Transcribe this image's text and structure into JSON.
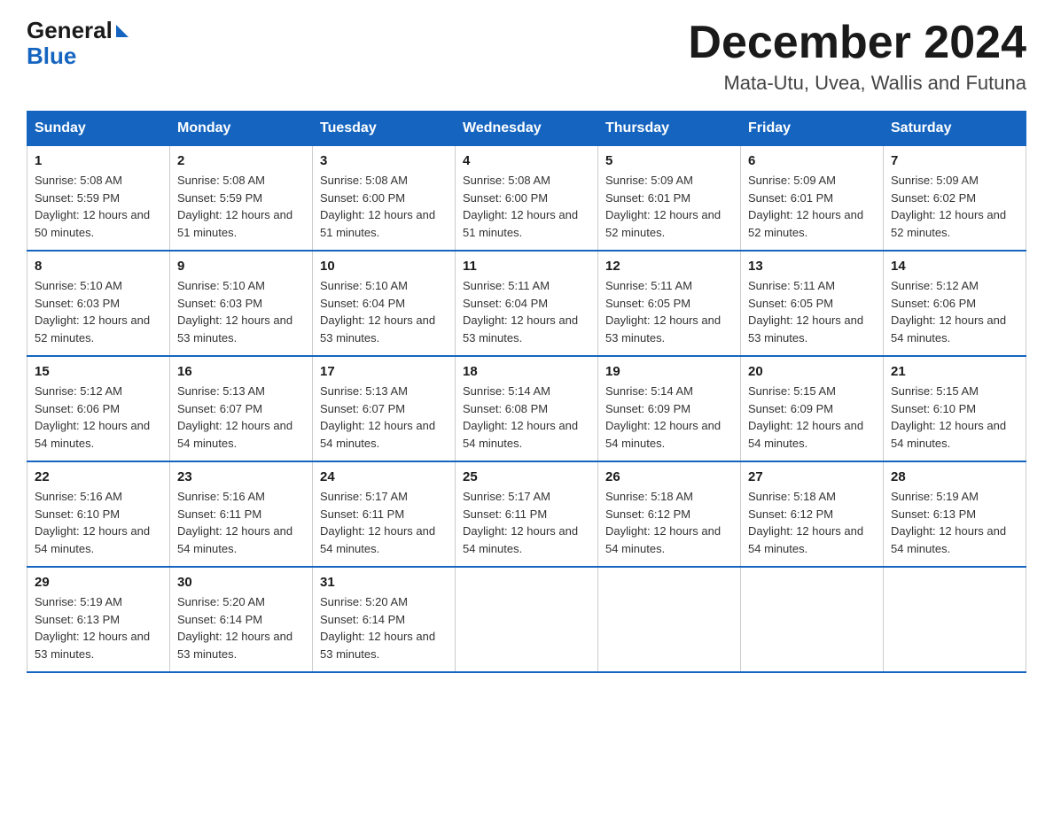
{
  "logo": {
    "general": "General",
    "blue": "Blue"
  },
  "title": "December 2024",
  "subtitle": "Mata-Utu, Uvea, Wallis and Futuna",
  "weekdays": [
    "Sunday",
    "Monday",
    "Tuesday",
    "Wednesday",
    "Thursday",
    "Friday",
    "Saturday"
  ],
  "weeks": [
    [
      {
        "day": "1",
        "sunrise": "5:08 AM",
        "sunset": "5:59 PM",
        "daylight": "12 hours and 50 minutes."
      },
      {
        "day": "2",
        "sunrise": "5:08 AM",
        "sunset": "5:59 PM",
        "daylight": "12 hours and 51 minutes."
      },
      {
        "day": "3",
        "sunrise": "5:08 AM",
        "sunset": "6:00 PM",
        "daylight": "12 hours and 51 minutes."
      },
      {
        "day": "4",
        "sunrise": "5:08 AM",
        "sunset": "6:00 PM",
        "daylight": "12 hours and 51 minutes."
      },
      {
        "day": "5",
        "sunrise": "5:09 AM",
        "sunset": "6:01 PM",
        "daylight": "12 hours and 52 minutes."
      },
      {
        "day": "6",
        "sunrise": "5:09 AM",
        "sunset": "6:01 PM",
        "daylight": "12 hours and 52 minutes."
      },
      {
        "day": "7",
        "sunrise": "5:09 AM",
        "sunset": "6:02 PM",
        "daylight": "12 hours and 52 minutes."
      }
    ],
    [
      {
        "day": "8",
        "sunrise": "5:10 AM",
        "sunset": "6:03 PM",
        "daylight": "12 hours and 52 minutes."
      },
      {
        "day": "9",
        "sunrise": "5:10 AM",
        "sunset": "6:03 PM",
        "daylight": "12 hours and 53 minutes."
      },
      {
        "day": "10",
        "sunrise": "5:10 AM",
        "sunset": "6:04 PM",
        "daylight": "12 hours and 53 minutes."
      },
      {
        "day": "11",
        "sunrise": "5:11 AM",
        "sunset": "6:04 PM",
        "daylight": "12 hours and 53 minutes."
      },
      {
        "day": "12",
        "sunrise": "5:11 AM",
        "sunset": "6:05 PM",
        "daylight": "12 hours and 53 minutes."
      },
      {
        "day": "13",
        "sunrise": "5:11 AM",
        "sunset": "6:05 PM",
        "daylight": "12 hours and 53 minutes."
      },
      {
        "day": "14",
        "sunrise": "5:12 AM",
        "sunset": "6:06 PM",
        "daylight": "12 hours and 54 minutes."
      }
    ],
    [
      {
        "day": "15",
        "sunrise": "5:12 AM",
        "sunset": "6:06 PM",
        "daylight": "12 hours and 54 minutes."
      },
      {
        "day": "16",
        "sunrise": "5:13 AM",
        "sunset": "6:07 PM",
        "daylight": "12 hours and 54 minutes."
      },
      {
        "day": "17",
        "sunrise": "5:13 AM",
        "sunset": "6:07 PM",
        "daylight": "12 hours and 54 minutes."
      },
      {
        "day": "18",
        "sunrise": "5:14 AM",
        "sunset": "6:08 PM",
        "daylight": "12 hours and 54 minutes."
      },
      {
        "day": "19",
        "sunrise": "5:14 AM",
        "sunset": "6:09 PM",
        "daylight": "12 hours and 54 minutes."
      },
      {
        "day": "20",
        "sunrise": "5:15 AM",
        "sunset": "6:09 PM",
        "daylight": "12 hours and 54 minutes."
      },
      {
        "day": "21",
        "sunrise": "5:15 AM",
        "sunset": "6:10 PM",
        "daylight": "12 hours and 54 minutes."
      }
    ],
    [
      {
        "day": "22",
        "sunrise": "5:16 AM",
        "sunset": "6:10 PM",
        "daylight": "12 hours and 54 minutes."
      },
      {
        "day": "23",
        "sunrise": "5:16 AM",
        "sunset": "6:11 PM",
        "daylight": "12 hours and 54 minutes."
      },
      {
        "day": "24",
        "sunrise": "5:17 AM",
        "sunset": "6:11 PM",
        "daylight": "12 hours and 54 minutes."
      },
      {
        "day": "25",
        "sunrise": "5:17 AM",
        "sunset": "6:11 PM",
        "daylight": "12 hours and 54 minutes."
      },
      {
        "day": "26",
        "sunrise": "5:18 AM",
        "sunset": "6:12 PM",
        "daylight": "12 hours and 54 minutes."
      },
      {
        "day": "27",
        "sunrise": "5:18 AM",
        "sunset": "6:12 PM",
        "daylight": "12 hours and 54 minutes."
      },
      {
        "day": "28",
        "sunrise": "5:19 AM",
        "sunset": "6:13 PM",
        "daylight": "12 hours and 54 minutes."
      }
    ],
    [
      {
        "day": "29",
        "sunrise": "5:19 AM",
        "sunset": "6:13 PM",
        "daylight": "12 hours and 53 minutes."
      },
      {
        "day": "30",
        "sunrise": "5:20 AM",
        "sunset": "6:14 PM",
        "daylight": "12 hours and 53 minutes."
      },
      {
        "day": "31",
        "sunrise": "5:20 AM",
        "sunset": "6:14 PM",
        "daylight": "12 hours and 53 minutes."
      },
      null,
      null,
      null,
      null
    ]
  ]
}
